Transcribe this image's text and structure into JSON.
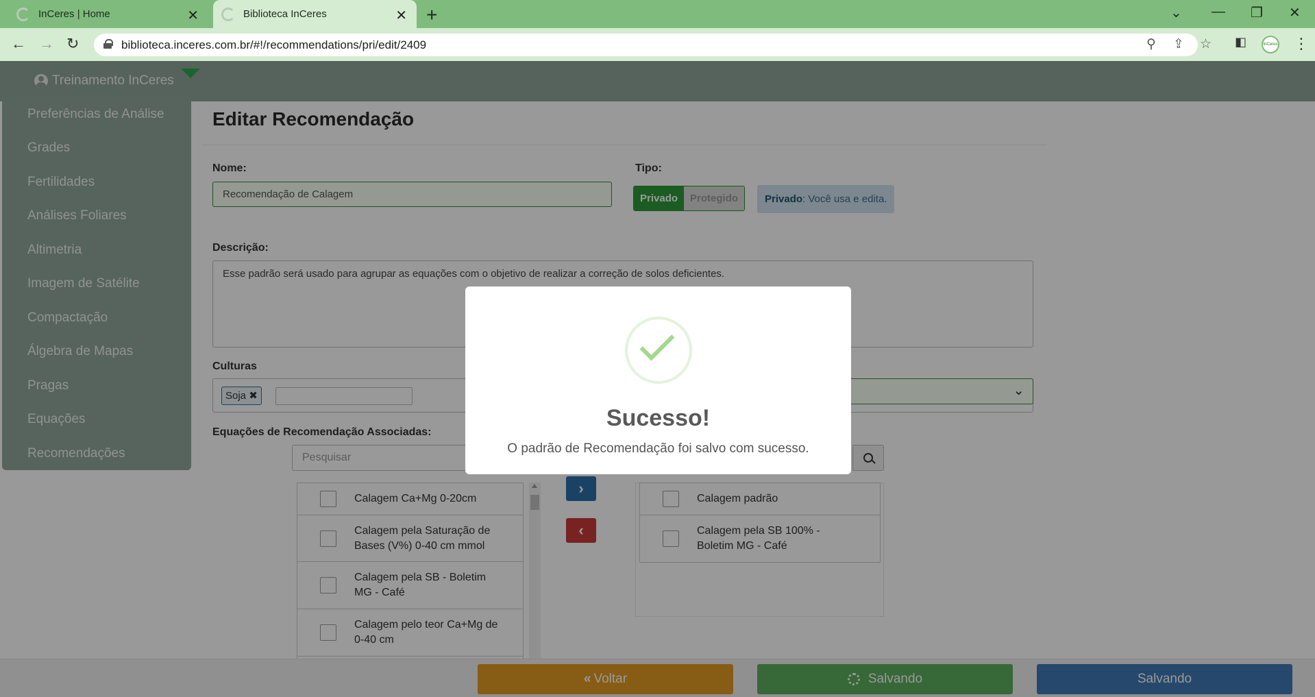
{
  "browser": {
    "tabs": [
      {
        "title": "InCeres | Home"
      },
      {
        "title": "Biblioteca InCeres"
      }
    ],
    "url": "biblioteca.inceres.com.br/#!/recommendations/pri/edit/2409",
    "profile_text": "InCeres"
  },
  "header": {
    "user": "Treinamento InCeres"
  },
  "sidebar": {
    "items": [
      {
        "label": "Preferências de Análise"
      },
      {
        "label": "Grades"
      },
      {
        "label": "Fertilidades"
      },
      {
        "label": "Análises Foliares"
      },
      {
        "label": "Altimetria"
      },
      {
        "label": "Imagem de Satélite"
      },
      {
        "label": "Compactação"
      },
      {
        "label": "Álgebra de Mapas"
      },
      {
        "label": "Pragas"
      },
      {
        "label": "Equações"
      },
      {
        "label": "Recomendações"
      }
    ]
  },
  "form": {
    "title": "Editar Recomendação",
    "name_label": "Nome:",
    "name_value": "Recomendação de Calagem",
    "tipo_label": "Tipo:",
    "tipo_options": {
      "privado": "Privado",
      "protegido": "Protegido"
    },
    "tipo_info_bold": "Privado",
    "tipo_info_text": ": Você usa e edita.",
    "desc_label": "Descrição:",
    "desc_value": "Esse padrão será usado para agrupar as equações com o objetivo de realizar a correção de solos deficientes.",
    "culturas_label": "Culturas",
    "culturas_tags": [
      "Soja"
    ],
    "equacoes_label": "Equações de Recomendação Associadas:",
    "search_placeholder": "Pesquisar",
    "left_list": [
      "Calagem Ca+Mg 0-20cm",
      "Calagem pela Saturação de Bases (V%) 0-40 cm mmol",
      "Calagem pela SB - Boletim MG - Café",
      "Calagem pelo teor Ca+Mg de 0-40 cm"
    ],
    "right_list": [
      "Calagem padrão",
      "Calagem pela SB 100% - Boletim MG - Café"
    ]
  },
  "footer": {
    "voltar": "Voltar",
    "salvando1": "Salvando",
    "salvando2": "Salvando"
  },
  "modal": {
    "title": "Sucesso!",
    "text": "O padrão de Recomendação foi salvo com sucesso."
  },
  "colors": {
    "browser_accent": "#7ebb7c",
    "success_green": "#2e9a3a",
    "voltar_orange": "#e29a24",
    "primary_blue": "#3f79b4",
    "danger_red": "#c93a3a"
  }
}
